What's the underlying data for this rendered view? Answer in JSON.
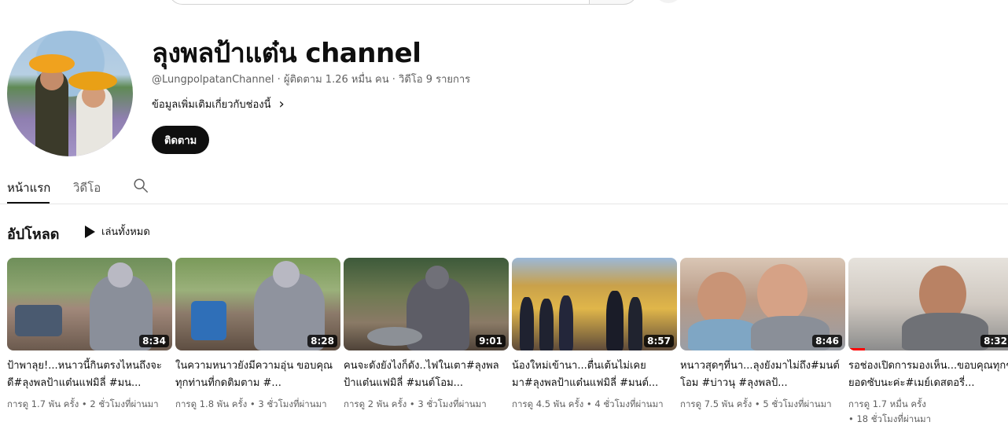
{
  "channel": {
    "name": "ลุงพลป้าแต๋น channel",
    "handle": "@LungpolpatanChannel",
    "meta_rest": " · ผู้ติดตาม 1.26 หมื่น คน · วิดีโอ 9 รายการ",
    "about": "ข้อมูลเพิ่มเติมเกี่ยวกับช่องนี้",
    "subscribe_label": "ติดตาม"
  },
  "tabs": [
    {
      "label": "หน้าแรก",
      "active": true
    },
    {
      "label": "วิดีโอ",
      "active": false
    }
  ],
  "uploads": {
    "title": "อัปโหลด",
    "play_all": "เล่นทั้งหมด",
    "videos": [
      {
        "title": "ป้าพาลุย!...หนาวนี้กินตรงไหนถึงจะดี#ลุงพลป้าแต๋นแฟมิลี่ #มน...",
        "duration": "8:34",
        "views": "การดู 1.7 พัน ครั้ง",
        "ago": "2 ชั่วโมงที่ผ่านมา"
      },
      {
        "title": "ในความหนาวยังมีความอุ่น ขอบคุณทุกท่านที่กดติมตาม #...",
        "duration": "8:28",
        "views": "การดู 1.8 พัน ครั้ง",
        "ago": "3 ชั่วโมงที่ผ่านมา"
      },
      {
        "title": "คนจะดังยังไงก็ดัง..ไฟในเตา#ลุงพลป้าแต๋นแฟมิลี่ #มนต์โอม...",
        "duration": "9:01",
        "views": "การดู 2 พัน ครั้ง",
        "ago": "3 ชั่วโมงที่ผ่านมา"
      },
      {
        "title": "น้องใหม่เข้านา...ตื่นเต้นไม่เคยมา#ลุงพลป้าแต๋นแฟมิลี่ #มนต์...",
        "duration": "8:57",
        "views": "การดู 4.5 พัน ครั้ง",
        "ago": "4 ชั่วโมงที่ผ่านมา"
      },
      {
        "title": "หนาวสุดๆที่นา...ลุงยังมาไม่ถึง#มนต์โอม #บ่าวนุ #ลุงพลป้...",
        "duration": "8:46",
        "views": "การดู 7.5 พัน ครั้ง",
        "ago": "5 ชั่วโมงที่ผ่านมา"
      },
      {
        "title": "รอช่องเปิดการมองเห็น...ขอบคุณทุกๆยอดซับนะค่ะ#เมย์เดสตอรี่...",
        "duration": "8:32",
        "views": "การดู 1.7 หมื่น ครั้ง",
        "ago": "18 ชั่วโมงที่ผ่านมา",
        "progress_fraction": 0.1
      }
    ]
  }
}
